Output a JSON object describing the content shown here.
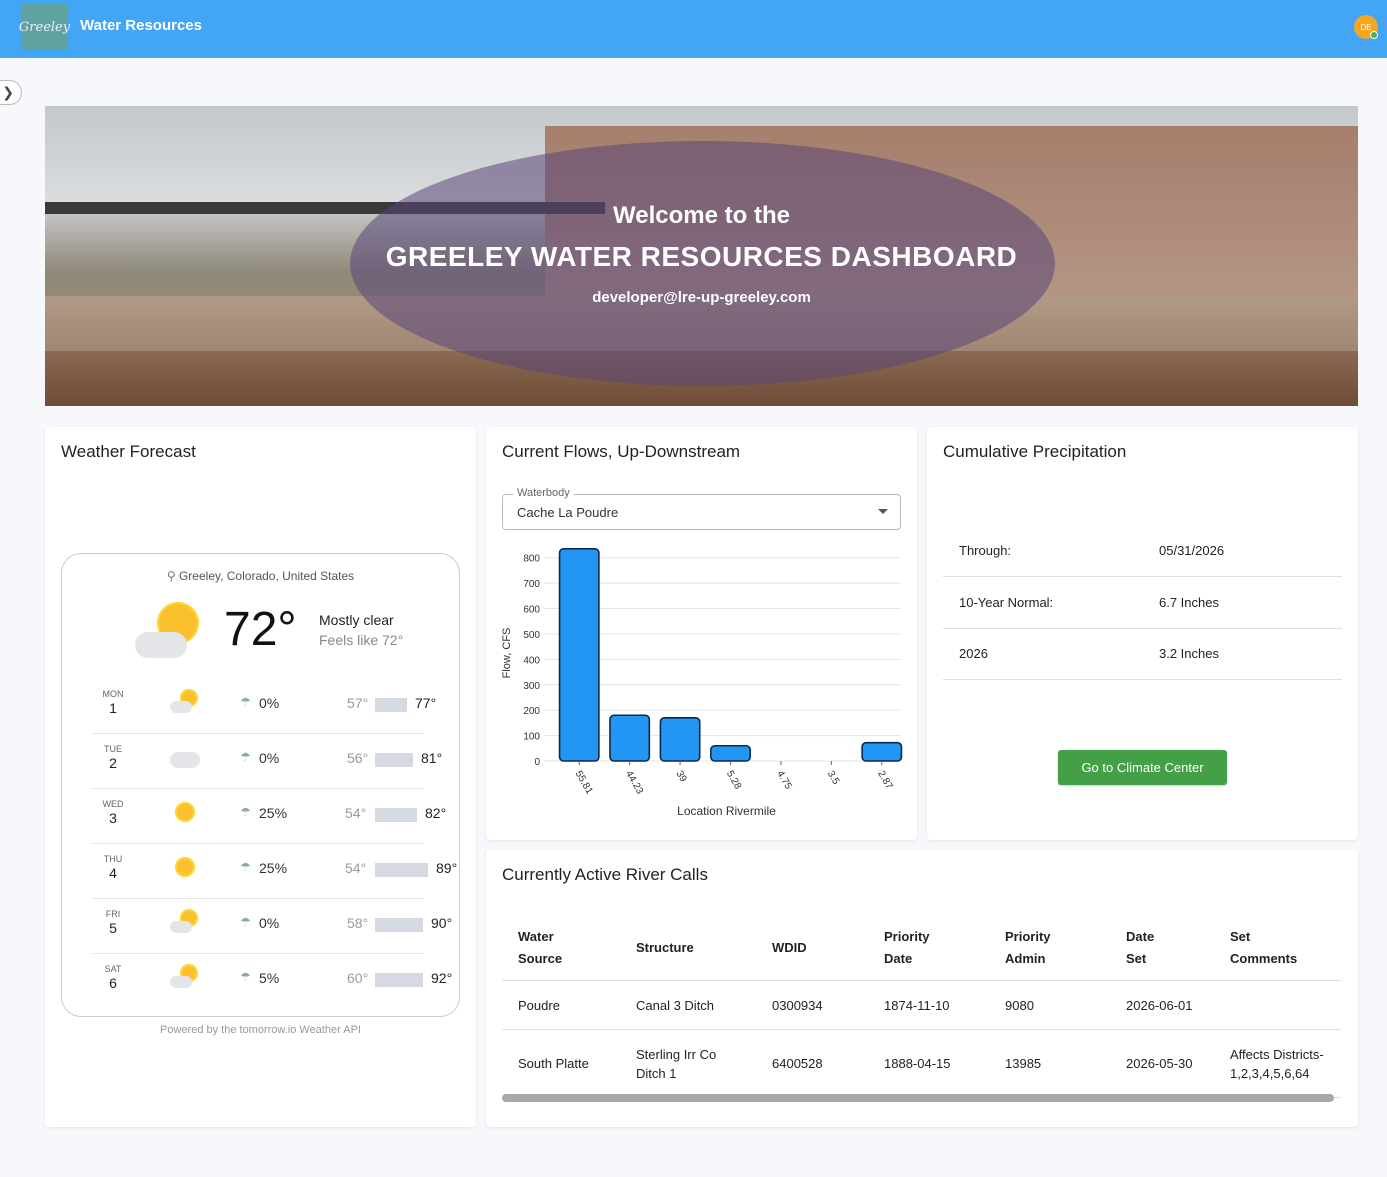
{
  "app": {
    "title": "Water Resources",
    "logo_text": "Greeley",
    "avatar_initials": "DE"
  },
  "hero": {
    "welcome": "Welcome to the",
    "title": "GREELEY WATER RESOURCES DASHBOARD",
    "email": "developer@lre-up-greeley.com"
  },
  "weather": {
    "card_title": "Weather Forecast",
    "location": "Greeley, Colorado, United States",
    "current_temp": "72°",
    "condition": "Mostly clear",
    "feels_like": "Feels like 72°",
    "powered_by": "Powered by the  tomorrow.io Weather API",
    "days": [
      {
        "name": "MON",
        "num": "1",
        "icon": "partly-sunny-icon",
        "pop": "0%",
        "low": "57°",
        "high": "77°"
      },
      {
        "name": "TUE",
        "num": "2",
        "icon": "cloud-icon",
        "pop": "0%",
        "low": "56°",
        "high": "81°"
      },
      {
        "name": "WED",
        "num": "3",
        "icon": "sun-icon",
        "pop": "25%",
        "low": "54°",
        "high": "82°"
      },
      {
        "name": "THU",
        "num": "4",
        "icon": "sun-icon",
        "pop": "25%",
        "low": "54°",
        "high": "89°"
      },
      {
        "name": "FRI",
        "num": "5",
        "icon": "partly-sunny-icon",
        "pop": "0%",
        "low": "58°",
        "high": "90°"
      },
      {
        "name": "SAT",
        "num": "6",
        "icon": "partly-sunny-icon",
        "pop": "5%",
        "low": "60°",
        "high": "92°"
      }
    ]
  },
  "flows": {
    "card_title": "Current Flows, Up-Downstream",
    "select_label": "Waterbody",
    "select_value": "Cache La Poudre"
  },
  "chart_data": {
    "type": "bar",
    "categories": [
      "55.81",
      "44.23",
      "39",
      "5.28",
      "4.75",
      "3.5",
      "2.87"
    ],
    "values": [
      835,
      180,
      170,
      60,
      0,
      0,
      72
    ],
    "xlabel": "Location Rivermile",
    "ylabel": "Flow, CFS",
    "ylim": [
      0,
      850
    ],
    "yticks": [
      0,
      100,
      200,
      300,
      400,
      500,
      600,
      700,
      800
    ],
    "bar_color": "#2196f3",
    "grid": true
  },
  "precip": {
    "card_title": "Cumulative Precipitation",
    "rows": [
      {
        "label": "Through:",
        "value": "05/31/2026"
      },
      {
        "label": "10-Year Normal:",
        "value": "6.7 Inches"
      },
      {
        "label": "2026",
        "value": "3.2 Inches"
      }
    ],
    "button": "Go to Climate Center"
  },
  "river_calls": {
    "card_title": "Currently Active River Calls",
    "headers": [
      [
        "Water",
        "Source"
      ],
      [
        "Structure"
      ],
      [
        "WDID"
      ],
      [
        "Priority",
        "Date"
      ],
      [
        "Priority",
        "Admin"
      ],
      [
        "Date",
        "Set"
      ],
      [
        "Set",
        "Comments"
      ]
    ],
    "rows": [
      [
        "Poudre",
        "Canal 3 Ditch",
        "0300934",
        "1874-11-10",
        "9080",
        "2026-06-01",
        ""
      ],
      [
        "South Platte",
        "Sterling Irr Co Ditch 1",
        "6400528",
        "1888-04-15",
        "13985",
        "2026-05-30",
        "Affects Districts-1,2,3,4,5,6,64"
      ]
    ]
  }
}
